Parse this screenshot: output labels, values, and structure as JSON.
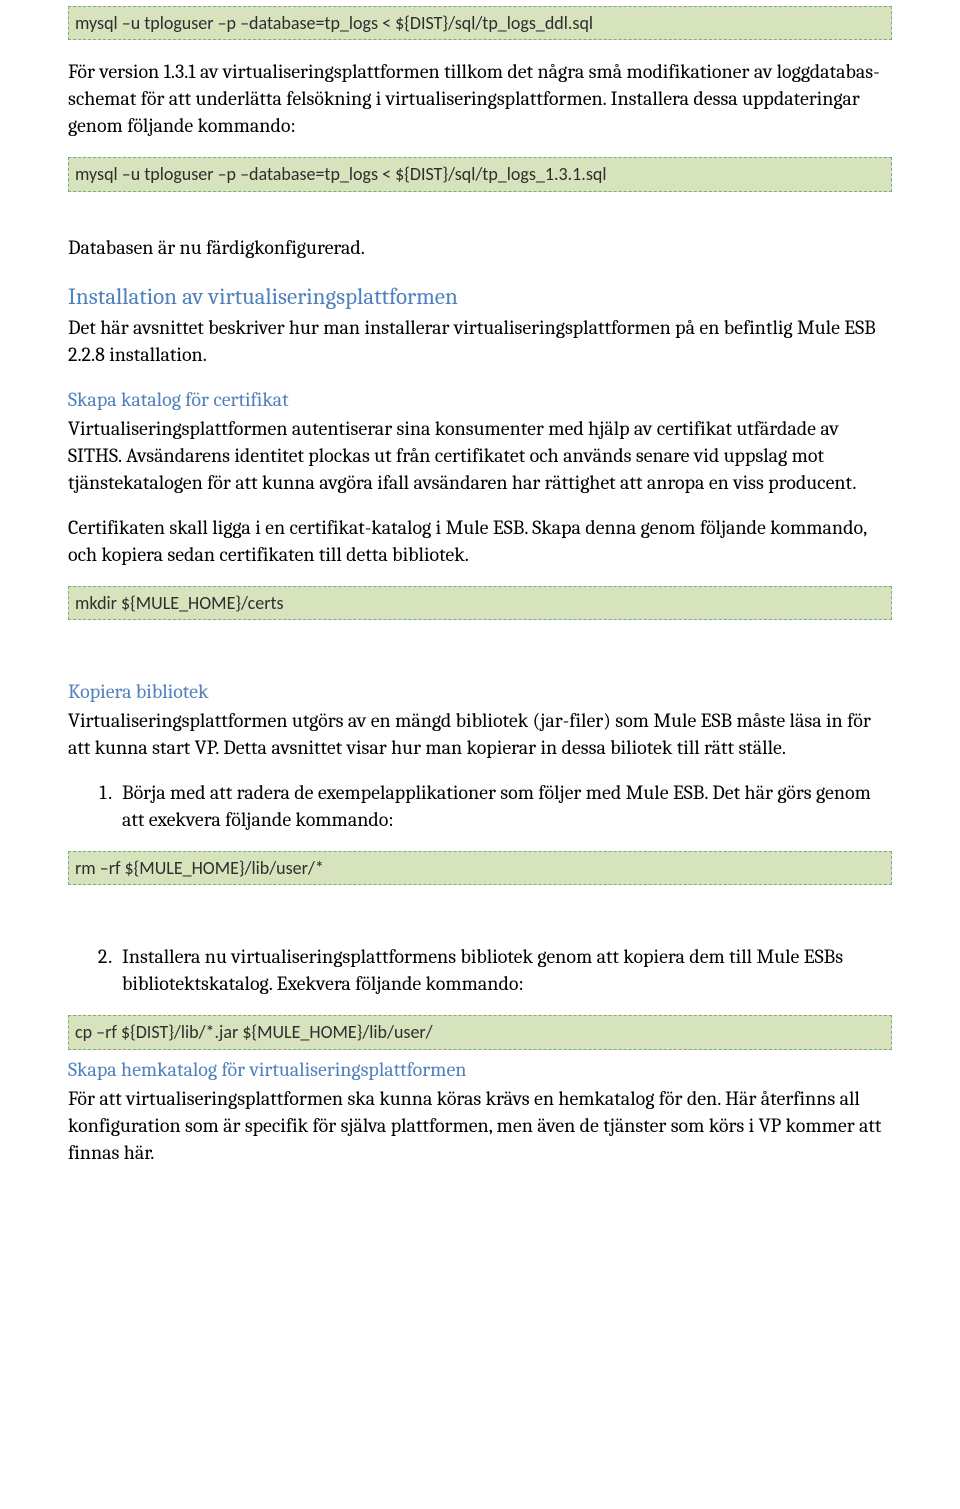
{
  "code_blocks": {
    "block1": "mysql –u tploguser –p –database=tp_logs < ${DIST}/sql/tp_logs_ddl.sql",
    "block2": "mysql –u tploguser –p –database=tp_logs < ${DIST}/sql/tp_logs_1.3.1.sql",
    "block3": "mkdir ${MULE_HOME}/certs",
    "block4": "rm –rf  ${MULE_HOME}/lib/user/*",
    "block5": "cp –rf ${DIST}/lib/*.jar ${MULE_HOME}/lib/user/"
  },
  "para": {
    "p1": "För version 1.3.1 av virtualiseringsplattformen tillkom det några små modifikationer av loggdatabas-schemat för att underlätta felsökning i virtualiseringsplattformen. Installera dessa uppdateringar genom följande kommando:",
    "p2": "Databasen är nu färdigkonfigurerad.",
    "h_install": "Installation av virtualiseringsplattformen",
    "p3": "Det här avsnittet beskriver hur man installerar virtualiseringsplattformen på en befintlig Mule ESB 2.2.8 installation.",
    "h_cert": "Skapa katalog för certifikat",
    "p4": "Virtualiseringsplattformen autentiserar sina konsumenter med hjälp av certifikat utfärdade av SITHS. Avsändarens identitet plockas ut från certifikatet och används senare vid uppslag mot tjänstekatalogen för att kunna avgöra ifall avsändaren har rättighet att anropa en viss producent.",
    "p5": "Certifikaten skall ligga i en certifikat-katalog i Mule ESB. Skapa denna genom följande kommando, och kopiera sedan certifikaten till detta bibliotek.",
    "h_kopiera": "Kopiera bibliotek",
    "p6": "Virtualiseringsplattformen utgörs av en mängd bibliotek (jar-filer) som Mule ESB måste läsa in för att kunna start VP. Detta avsnittet visar hur man kopierar in dessa biliotek till rätt ställe.",
    "li1": "Börja med att radera de exempelapplikationer som följer med Mule ESB. Det här görs genom att exekvera följande kommando:",
    "li2": "Installera nu virtualiseringsplattformens bibliotek genom att kopiera dem till Mule ESBs bibliotektskatalog. Exekvera följande kommando:",
    "h_hemkatalog": "Skapa hemkatalog för virtualiseringsplattformen",
    "p7": "För att virtualiseringsplattformen ska kunna köras krävs en hemkatalog för den. Här återfinns all konfiguration som är specifik för själva plattformen, men även de tjänster som körs i VP kommer att finnas här."
  }
}
